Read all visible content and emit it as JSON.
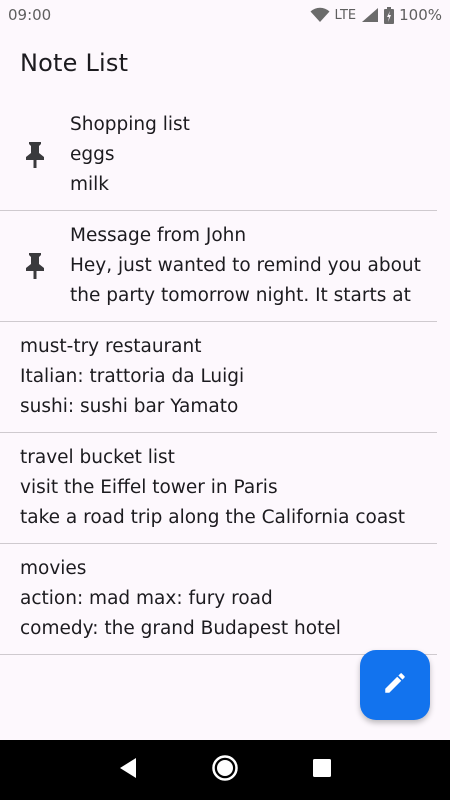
{
  "status_bar": {
    "time": "09:00",
    "network": "LTE",
    "battery": "100%"
  },
  "header": {
    "title": "Note List"
  },
  "notes": [
    {
      "pinned": true,
      "lines": [
        "Shopping list",
        "eggs",
        "milk"
      ]
    },
    {
      "pinned": true,
      "lines": [
        "Message from John",
        "Hey, just wanted to remind you about",
        "the party tomorrow night. It starts at"
      ]
    },
    {
      "pinned": false,
      "lines": [
        "must-try restaurant",
        "Italian: trattoria da Luigi",
        "sushi: sushi bar Yamato"
      ]
    },
    {
      "pinned": false,
      "lines": [
        "travel bucket list",
        "visit the Eiffel tower in Paris",
        "take a road trip along the California coast"
      ]
    },
    {
      "pinned": false,
      "lines": [
        "movies",
        "action: mad max: fury road",
        "comedy: the grand Budapest hotel"
      ]
    }
  ],
  "fab": {
    "icon": "edit-pencil-icon",
    "color": "#1273ee"
  },
  "nav": {
    "icons": [
      "back-icon",
      "home-icon",
      "recents-icon"
    ]
  }
}
